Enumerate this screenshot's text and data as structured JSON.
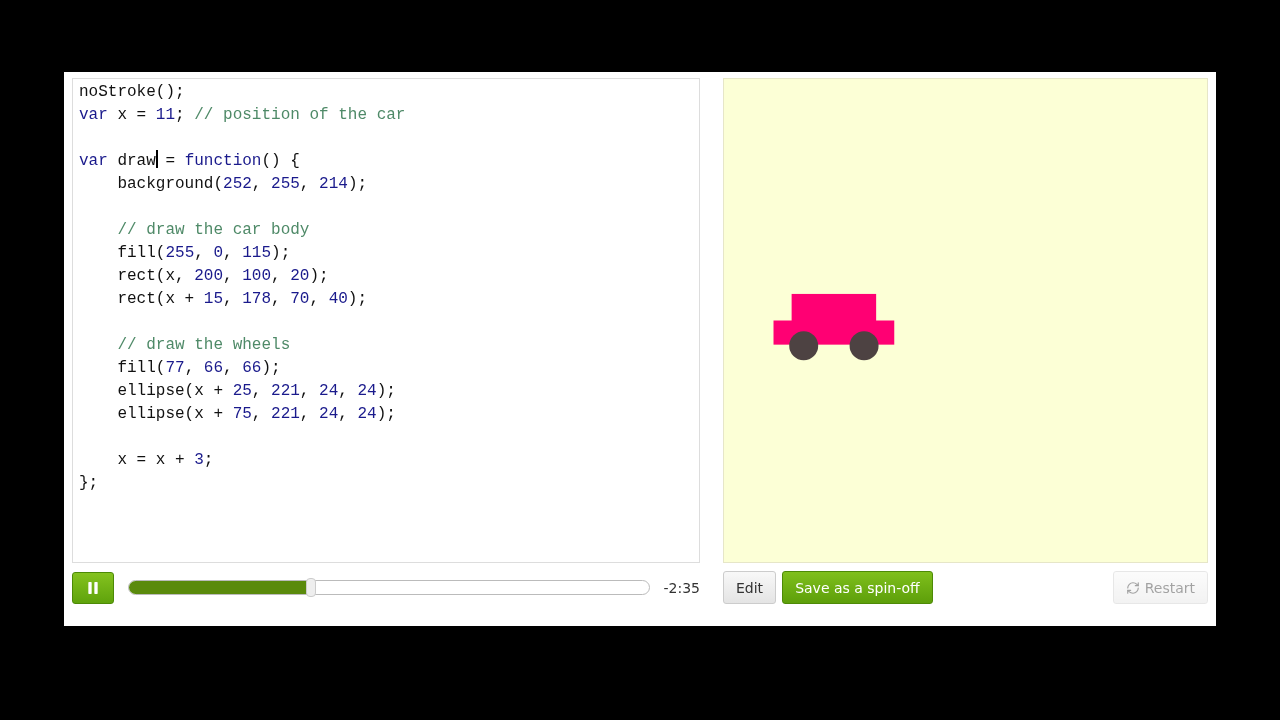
{
  "editor": {
    "lines": [
      {
        "kind": "code",
        "tokens": [
          {
            "text": "noStroke();",
            "kind": "plain"
          }
        ]
      },
      {
        "kind": "code",
        "tokens": [
          {
            "text": "var",
            "kind": "keyword"
          },
          {
            "text": " x = ",
            "kind": "plain"
          },
          {
            "text": "11",
            "kind": "number"
          },
          {
            "text": "; ",
            "kind": "plain"
          },
          {
            "text": "// position of the car",
            "kind": "comment"
          }
        ]
      },
      {
        "kind": "blank"
      },
      {
        "kind": "code",
        "tokens": [
          {
            "text": "var",
            "kind": "keyword"
          },
          {
            "text": " draw",
            "kind": "plain",
            "cursor": true
          },
          {
            "text": " = ",
            "kind": "plain"
          },
          {
            "text": "function",
            "kind": "keyword"
          },
          {
            "text": "() {",
            "kind": "plain"
          }
        ]
      },
      {
        "kind": "code",
        "tokens": [
          {
            "text": "    background(",
            "kind": "plain"
          },
          {
            "text": "252",
            "kind": "number"
          },
          {
            "text": ", ",
            "kind": "plain"
          },
          {
            "text": "255",
            "kind": "number"
          },
          {
            "text": ", ",
            "kind": "plain"
          },
          {
            "text": "214",
            "kind": "number"
          },
          {
            "text": ");",
            "kind": "plain"
          }
        ]
      },
      {
        "kind": "blank"
      },
      {
        "kind": "code",
        "tokens": [
          {
            "text": "    // draw the car body",
            "kind": "comment"
          }
        ]
      },
      {
        "kind": "code",
        "tokens": [
          {
            "text": "    fill(",
            "kind": "plain"
          },
          {
            "text": "255",
            "kind": "number"
          },
          {
            "text": ", ",
            "kind": "plain"
          },
          {
            "text": "0",
            "kind": "number"
          },
          {
            "text": ", ",
            "kind": "plain"
          },
          {
            "text": "115",
            "kind": "number"
          },
          {
            "text": ");",
            "kind": "plain"
          }
        ]
      },
      {
        "kind": "code",
        "tokens": [
          {
            "text": "    rect(x, ",
            "kind": "plain"
          },
          {
            "text": "200",
            "kind": "number"
          },
          {
            "text": ", ",
            "kind": "plain"
          },
          {
            "text": "100",
            "kind": "number"
          },
          {
            "text": ", ",
            "kind": "plain"
          },
          {
            "text": "20",
            "kind": "number"
          },
          {
            "text": ");",
            "kind": "plain"
          }
        ]
      },
      {
        "kind": "code",
        "tokens": [
          {
            "text": "    rect(x + ",
            "kind": "plain"
          },
          {
            "text": "15",
            "kind": "number"
          },
          {
            "text": ", ",
            "kind": "plain"
          },
          {
            "text": "178",
            "kind": "number"
          },
          {
            "text": ", ",
            "kind": "plain"
          },
          {
            "text": "70",
            "kind": "number"
          },
          {
            "text": ", ",
            "kind": "plain"
          },
          {
            "text": "40",
            "kind": "number"
          },
          {
            "text": ");",
            "kind": "plain"
          }
        ]
      },
      {
        "kind": "blank"
      },
      {
        "kind": "code",
        "tokens": [
          {
            "text": "    // draw the wheels",
            "kind": "comment"
          }
        ]
      },
      {
        "kind": "code",
        "tokens": [
          {
            "text": "    fill(",
            "kind": "plain"
          },
          {
            "text": "77",
            "kind": "number"
          },
          {
            "text": ", ",
            "kind": "plain"
          },
          {
            "text": "66",
            "kind": "number"
          },
          {
            "text": ", ",
            "kind": "plain"
          },
          {
            "text": "66",
            "kind": "number"
          },
          {
            "text": ");",
            "kind": "plain"
          }
        ]
      },
      {
        "kind": "code",
        "tokens": [
          {
            "text": "    ellipse(x + ",
            "kind": "plain"
          },
          {
            "text": "25",
            "kind": "number"
          },
          {
            "text": ", ",
            "kind": "plain"
          },
          {
            "text": "221",
            "kind": "number"
          },
          {
            "text": ", ",
            "kind": "plain"
          },
          {
            "text": "24",
            "kind": "number"
          },
          {
            "text": ", ",
            "kind": "plain"
          },
          {
            "text": "24",
            "kind": "number"
          },
          {
            "text": ");",
            "kind": "plain"
          }
        ]
      },
      {
        "kind": "code",
        "tokens": [
          {
            "text": "    ellipse(x + ",
            "kind": "plain"
          },
          {
            "text": "75",
            "kind": "number"
          },
          {
            "text": ", ",
            "kind": "plain"
          },
          {
            "text": "221",
            "kind": "number"
          },
          {
            "text": ", ",
            "kind": "plain"
          },
          {
            "text": "24",
            "kind": "number"
          },
          {
            "text": ", ",
            "kind": "plain"
          },
          {
            "text": "24",
            "kind": "number"
          },
          {
            "text": ");",
            "kind": "plain"
          }
        ]
      },
      {
        "kind": "blank"
      },
      {
        "kind": "code",
        "tokens": [
          {
            "text": "    x = x + ",
            "kind": "plain"
          },
          {
            "text": "3",
            "kind": "number"
          },
          {
            "text": ";",
            "kind": "plain"
          }
        ]
      },
      {
        "kind": "code",
        "tokens": [
          {
            "text": "};",
            "kind": "plain"
          }
        ]
      }
    ]
  },
  "player": {
    "playing": true,
    "level": 0.35,
    "time_left": "-2:35"
  },
  "buttons": [
    {
      "label": "Edit",
      "kind": "plain",
      "disabled": false
    },
    {
      "label": "Save as a spin-off",
      "kind": "primary",
      "disabled": false
    },
    {
      "label": "Restart",
      "kind": "restart",
      "disabled": true
    }
  ]
}
